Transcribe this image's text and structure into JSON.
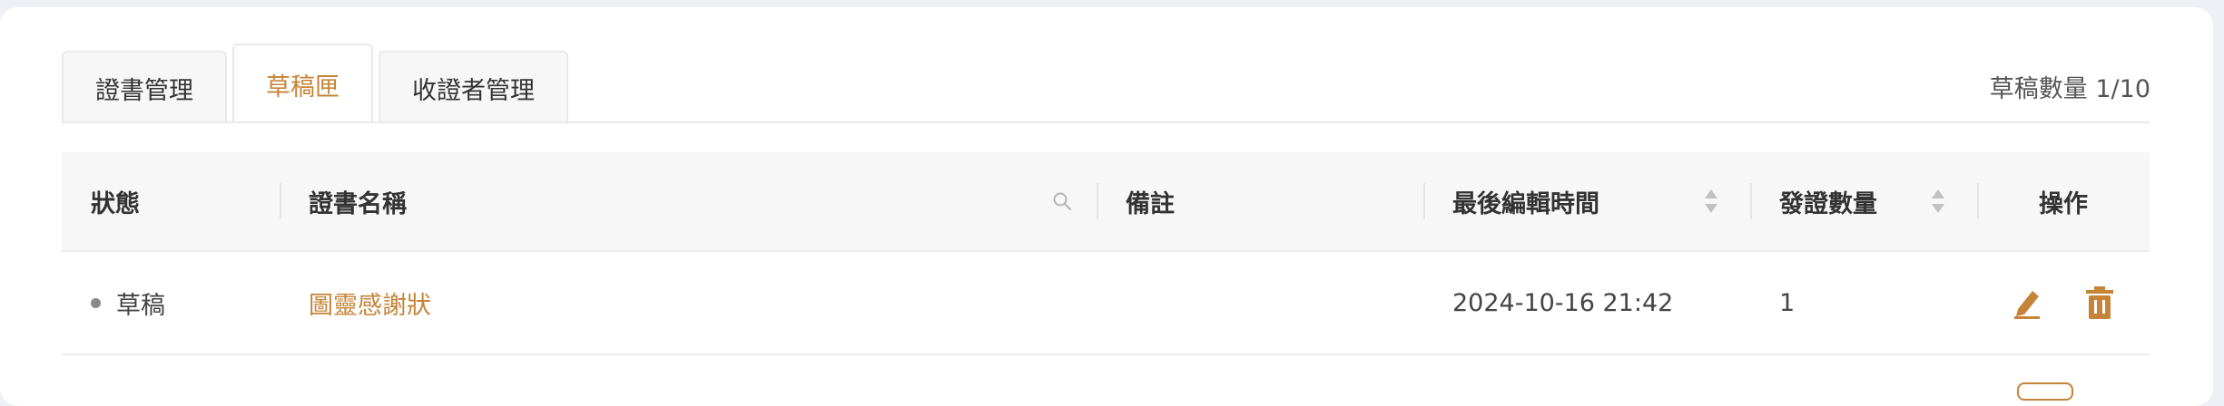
{
  "tabs": [
    {
      "label": "證書管理",
      "active": false
    },
    {
      "label": "草稿匣",
      "active": true
    },
    {
      "label": "收證者管理",
      "active": false
    }
  ],
  "draft_count": "草稿數量 1/10",
  "table": {
    "columns": [
      "狀態",
      "證書名稱",
      "備註",
      "最後編輯時間",
      "發證數量",
      "操作"
    ],
    "rows": [
      {
        "status": "草稿",
        "name": "圖靈感謝狀",
        "note": "",
        "edited": "2024-10-16 21:42",
        "issued": "1"
      }
    ]
  },
  "icons": {
    "search": "search-icon",
    "sort": "sort-icon",
    "edit": "edit-icon",
    "delete": "trash-icon"
  },
  "colors": {
    "accent": "#c68438",
    "status_dot": "#8a8a8a",
    "header_bg": "#f7f7f7"
  }
}
